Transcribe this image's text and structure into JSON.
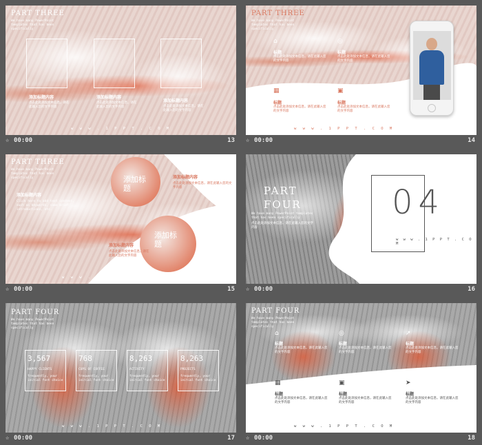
{
  "slides": [
    {
      "number": "13",
      "time": "00:00",
      "part_title": "PART THREE",
      "subtitle": "We have many PowerPoint templates that has been specifically",
      "captions": [
        "添加标题内容",
        "添加标题内容",
        "添加标题内容"
      ],
      "body": "点击此处添加文本信息，请在此输入您的文字内容",
      "site": "w w w . 1 P P T . C O M"
    },
    {
      "number": "14",
      "time": "00:00",
      "part_title": "PART THREE",
      "subtitle": "We have many PowerPoint templates that has been specifically",
      "features": [
        {
          "icon": "home-icon",
          "glyph": "⌂",
          "title": "标题",
          "text": "点击此处添加文本信息，请在此输入您的文字内容"
        },
        {
          "icon": "globe-icon",
          "glyph": "◎",
          "title": "标题",
          "text": "点击此处添加文本信息，请在此输入您的文字内容"
        },
        {
          "icon": "calendar-icon",
          "glyph": "▦",
          "title": "标题",
          "text": "点击此处添加文本信息，请在此输入您的文字内容"
        },
        {
          "icon": "image-icon",
          "glyph": "▣",
          "title": "标题",
          "text": "点击此处添加文本信息，请在此输入您的文字内容"
        }
      ],
      "site": "w w w . 1 P P T . C O M"
    },
    {
      "number": "15",
      "time": "00:00",
      "part_title": "PART THREE",
      "subtitle": "We have many PowerPoint templates that has been specifically",
      "left_heading": "添加标题内容",
      "left_body": "Click here to add text content, such as keywords, some brief introductions, etc.",
      "circle1": "添加标题",
      "circle2": "添加标题",
      "right_heading1": "添加标题内容",
      "right_heading2": "添加标题内容",
      "right_body": "点击此处添加文本信息，请在此输入您的文字内容",
      "site": "w w w . 1 P P T . C O M"
    },
    {
      "number": "16",
      "time": "00:00",
      "part_line1": "PART",
      "part_line2": "FOUR",
      "subtitle": "We have many PowerPoint templates that has been specifically",
      "body": "点击此处添加文本信息，请在此输入您的文字内容",
      "big_number": "04",
      "site": "w w w . 1 P P T . C O M"
    },
    {
      "number": "17",
      "time": "00:00",
      "part_title": "PART FOUR",
      "subtitle": "We have many PowerPoint templates that has been specifically",
      "stats": [
        {
          "value": "3,567",
          "label": "HAPPY CLIENTS",
          "text": "frequently, your initial font choice"
        },
        {
          "value": "768",
          "label": "CUPS OF COFFEE",
          "text": "frequently, your initial font choice"
        },
        {
          "value": "8,263",
          "label": "ACTIVITY",
          "text": "frequently, your initial font choice"
        },
        {
          "value": "8,263",
          "label": "PROJECTS",
          "text": "frequently, your initial font choice"
        }
      ],
      "site": "w w w . 1 P P T . C O M"
    },
    {
      "number": "18",
      "time": "00:00",
      "part_title": "PART FOUR",
      "subtitle": "We have many PowerPoint templates that has been specifically",
      "top_features": [
        {
          "icon": "home-icon",
          "glyph": "⌂",
          "title": "标题",
          "text": "点击此处添加文本信息，请在此输入您的文字内容"
        },
        {
          "icon": "globe-icon",
          "glyph": "◎",
          "title": "标题",
          "text": "点击此处添加文本信息，请在此输入您的文字内容"
        },
        {
          "icon": "rocket-icon",
          "glyph": "➚",
          "title": "标题",
          "text": "点击此处添加文本信息，请在此输入您的文字内容"
        }
      ],
      "bottom_features": [
        {
          "icon": "calendar-icon",
          "glyph": "▦",
          "title": "标题",
          "text": "点击此处添加文本信息，请在此输入您的文字内容"
        },
        {
          "icon": "image-icon",
          "glyph": "▣",
          "title": "标题",
          "text": "点击此处添加文本信息，请在此输入您的文字内容"
        },
        {
          "icon": "send-icon",
          "glyph": "➤",
          "title": "标题",
          "text": "点击此处添加文本信息，请在此输入您的文字内容"
        }
      ],
      "site": "w w w . 1 P P T . C O M"
    }
  ],
  "colors": {
    "accent": "#e8532c",
    "gray_bg": "#595959",
    "title_pink": "#d9775f"
  }
}
